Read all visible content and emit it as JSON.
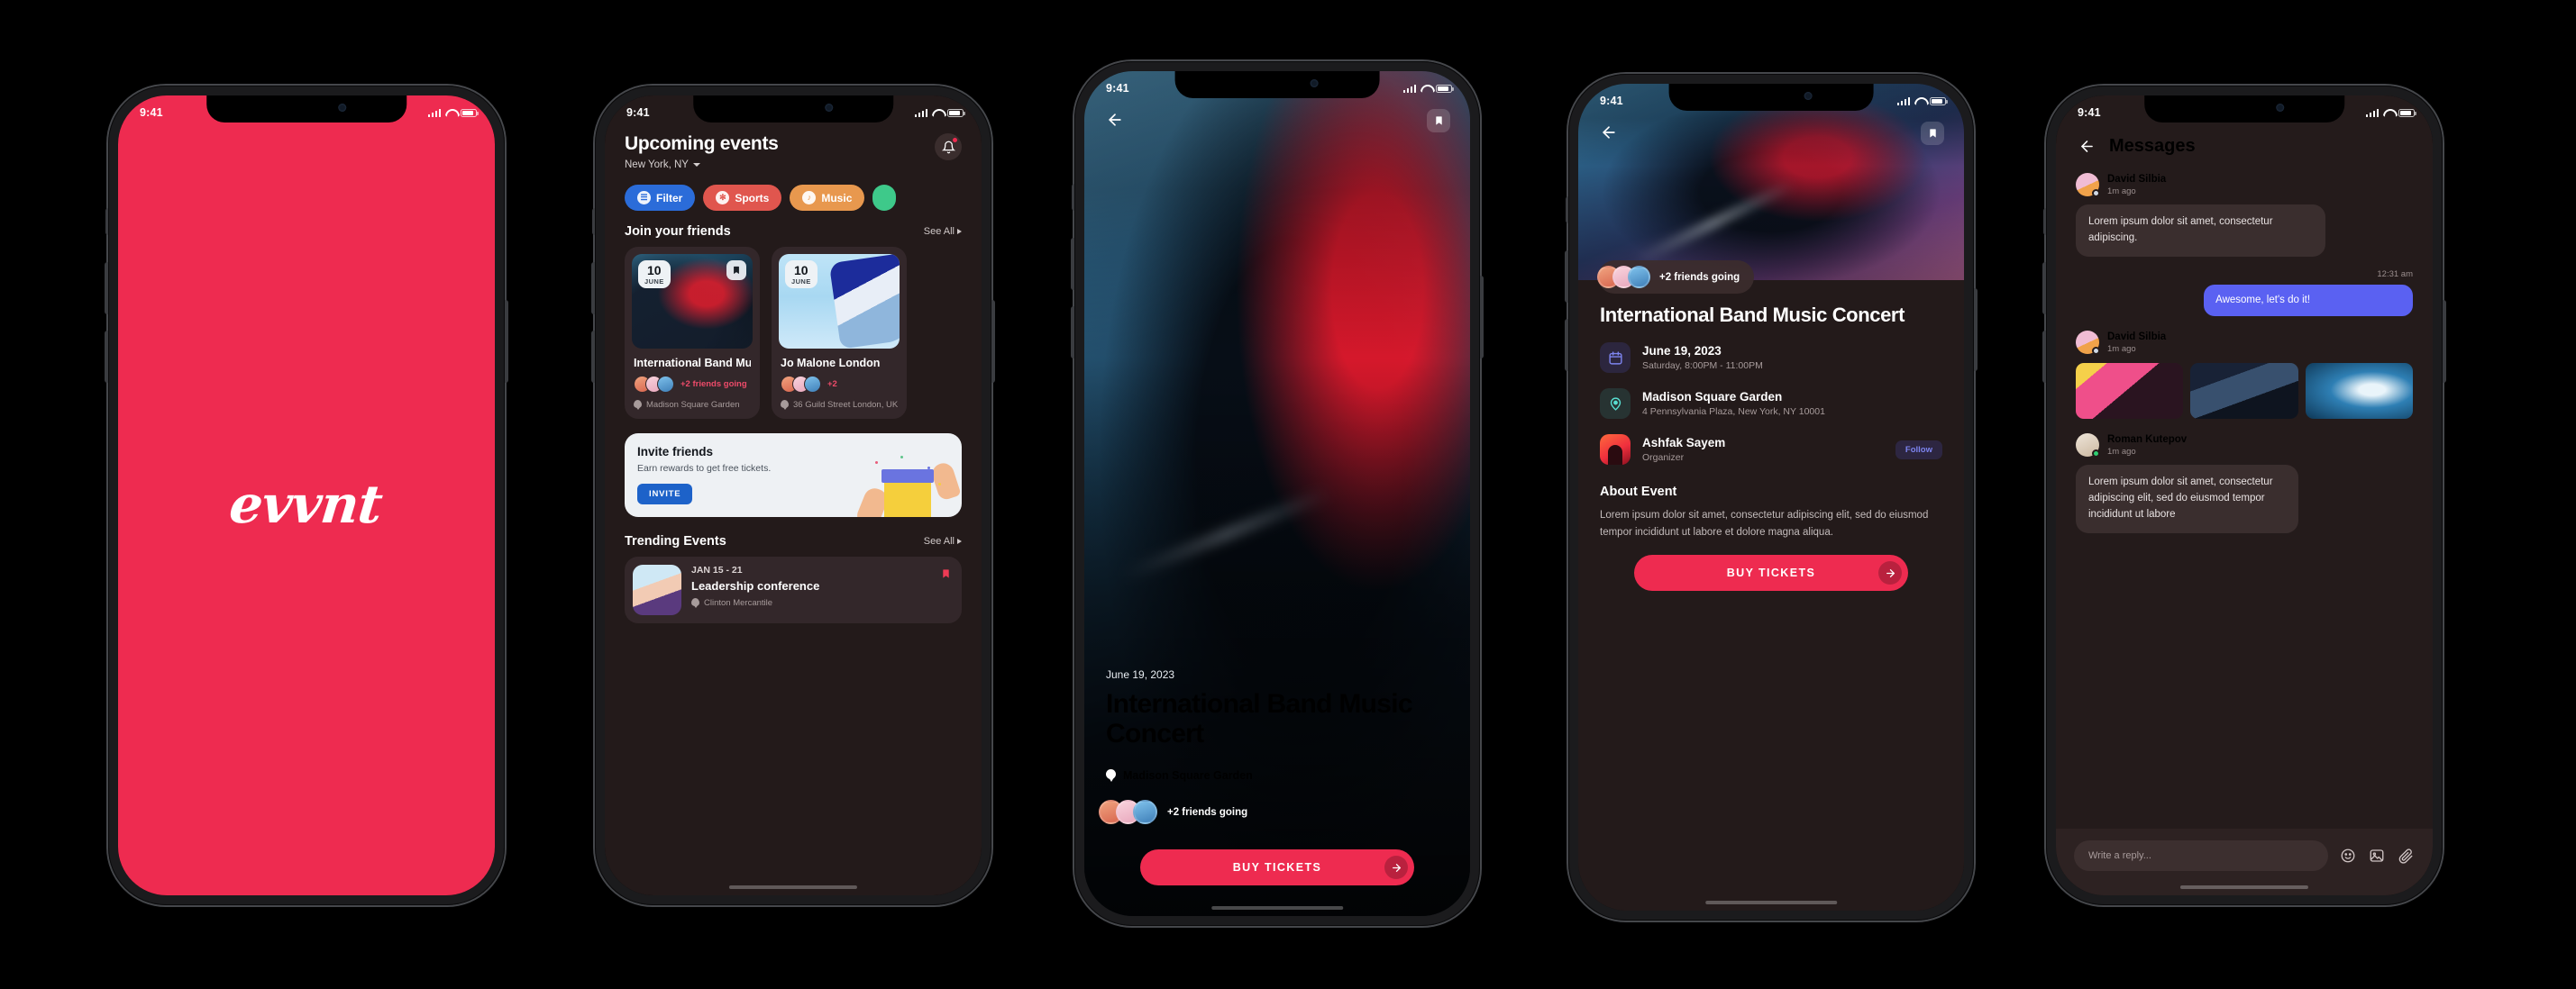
{
  "canvas": {
    "background": "#000000",
    "accent": "#ee2b50"
  },
  "status_bar": {
    "time": "9:41",
    "icons": [
      "cellular-bars",
      "wifi",
      "battery"
    ]
  },
  "screens": [
    {
      "name": "splash",
      "wordmark": "evvnt",
      "background": "#ee2b50"
    },
    {
      "name": "upcoming-events",
      "title": "Upcoming events",
      "location": "New York, NY",
      "notification_icon": "bell-icon",
      "chips": [
        {
          "label": "Filter",
          "color": "#2b6cd9",
          "icon": "filter-icon",
          "glyph": "≡"
        },
        {
          "label": "Sports",
          "color": "#e0564e",
          "icon": "basketball-icon",
          "glyph": "✻"
        },
        {
          "label": "Music",
          "color": "#e8984e",
          "icon": "music-note-icon",
          "glyph": "♫"
        },
        {
          "label": "",
          "color": "#3ec98a",
          "icon": "category-icon",
          "glyph": ""
        }
      ],
      "sections": [
        {
          "heading": "Join your friends",
          "see_all": "See All"
        },
        {
          "heading": "Trending Events",
          "see_all": "See All"
        }
      ],
      "event_cards": [
        {
          "day": "10",
          "month": "JUNE",
          "name": "International Band Mu...",
          "friends": "+2 friends going",
          "venue": "Madison Square Garden",
          "bookmarked": true
        },
        {
          "day": "10",
          "month": "JUNE",
          "name": "Jo Malone London",
          "friends": "+2",
          "venue": "36 Guild Street London, UK",
          "bookmarked": false
        }
      ],
      "invite": {
        "title": "Invite friends",
        "subtitle": "Earn rewards to get free tickets.",
        "button": "INVITE"
      },
      "trending": {
        "date": "JAN 15 - 21",
        "title": "Leadership conference",
        "venue": "Clinton Mercantile"
      }
    },
    {
      "name": "event-hero",
      "back_icon": "arrow-left-icon",
      "bookmark_icon": "bookmark-icon",
      "date": "June 19, 2023",
      "title": "International Band Music Concert",
      "venue": "Madison Square Garden",
      "friends": "+2 friends going",
      "cta": "BUY TICKETS",
      "cta_icon": "arrow-right-icon"
    },
    {
      "name": "event-details",
      "back_icon": "arrow-left-icon",
      "bookmark_icon": "bookmark-icon",
      "friends_pill": "+2 friends going",
      "title": "International Band Music Concert",
      "rows": [
        {
          "icon": "calendar-icon",
          "main": "June 19, 2023",
          "sub": "Saturday, 8:00PM - 11:00PM"
        },
        {
          "icon": "location-pin-icon",
          "main": "Madison Square Garden",
          "sub": "4 Pennsylvania Plaza, New York, NY 10001"
        },
        {
          "icon": "organizer-avatar",
          "main": "Ashfak Sayem",
          "sub": "Organizer",
          "action": "Follow"
        }
      ],
      "about_heading": "About Event",
      "about_text": "Lorem ipsum dolor sit amet, consectetur adipiscing elit, sed do eiusmod tempor incididunt ut labore et dolore magna aliqua.",
      "cta": "BUY TICKETS",
      "cta_icon": "arrow-right-icon"
    },
    {
      "name": "messages",
      "back_icon": "arrow-left-icon",
      "title": "Messages",
      "messages": [
        {
          "sender": "David  Silbia",
          "time": "1m ago",
          "text": "Lorem ipsum dolor sit amet, consectetur adipiscing.",
          "type": "in"
        },
        {
          "stamp": "12:31 am",
          "text": "Awesome, let's do it!",
          "type": "out"
        },
        {
          "sender": "David  Silbia",
          "time": "1m ago",
          "type": "gallery",
          "images": [
            "concert-phone-photo",
            "crowd-photo",
            "confetti-stage-photo"
          ]
        },
        {
          "sender": "Roman Kutepov",
          "time": "1m ago",
          "text": "Lorem ipsum dolor sit amet, consectetur adipiscing elit, sed do eiusmod tempor incididunt ut labore",
          "type": "in"
        }
      ],
      "composer": {
        "placeholder": "Write a reply...",
        "icons": [
          "emoji-icon",
          "image-icon",
          "attachment-icon"
        ]
      }
    }
  ]
}
